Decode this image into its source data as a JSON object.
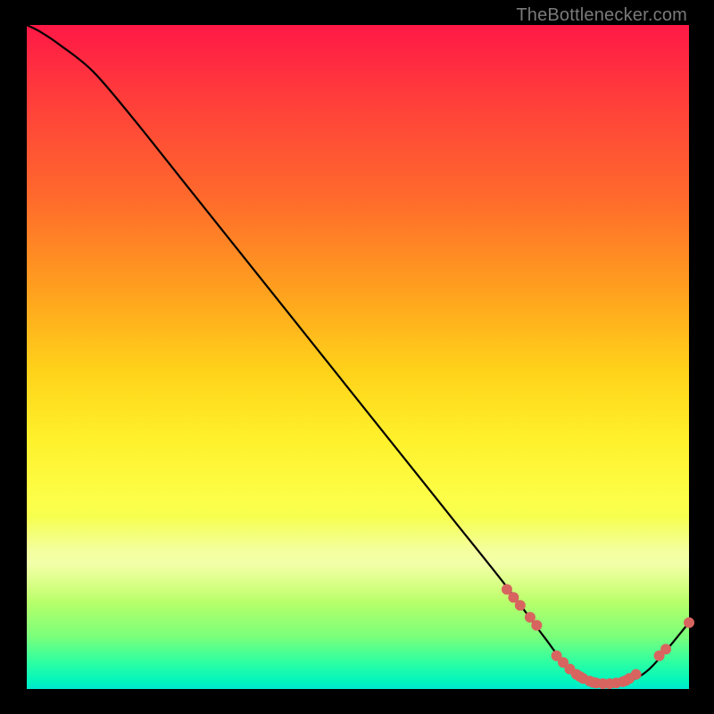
{
  "watermark": "TheBottlenecker.com",
  "chart_data": {
    "type": "line",
    "title": "",
    "xlabel": "",
    "ylabel": "",
    "xlim": [
      0,
      100
    ],
    "ylim": [
      0,
      100
    ],
    "x": [
      0,
      2,
      5,
      10,
      16,
      24,
      32,
      40,
      48,
      56,
      64,
      72,
      78,
      82,
      86,
      90,
      94,
      100
    ],
    "values": [
      100,
      99,
      97,
      93,
      86,
      76,
      66,
      56,
      46,
      36,
      26,
      16,
      8,
      3,
      1,
      1,
      3,
      10
    ],
    "marker_points_x": [
      72.5,
      73.5,
      74.5,
      76,
      77,
      80,
      81,
      82,
      83,
      83.5,
      84,
      85,
      85.5,
      86,
      87,
      88,
      89,
      90,
      90.5,
      91,
      92,
      95.5,
      96.5,
      100
    ],
    "marker_points_y": [
      15,
      13.8,
      12.6,
      10.8,
      9.6,
      5.0,
      4.0,
      3.0,
      2.2,
      1.9,
      1.6,
      1.2,
      1.0,
      0.9,
      0.8,
      0.8,
      0.9,
      1.1,
      1.3,
      1.6,
      2.2,
      5.0,
      6.0,
      10
    ],
    "marker_color": "#d8645f",
    "marker_size": 6
  }
}
